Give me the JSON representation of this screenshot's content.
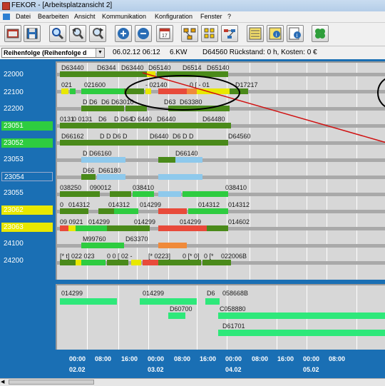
{
  "window": {
    "title": "FEKOR - [Arbeitsplatzansicht 2]"
  },
  "menu": [
    "Datei",
    "Bearbeiten",
    "Ansicht",
    "Kommunikation",
    "Konfiguration",
    "Fenster",
    "?"
  ],
  "toolbar": {
    "buttons": [
      "new-window-icon",
      "save-icon",
      "zoom-icon",
      "zoom-back-icon",
      "zoom-forward-icon",
      "zoom-in-icon",
      "zoom-out-icon",
      "calendar-icon",
      "structure-icon",
      "grid-icon",
      "network-icon",
      "list-icon",
      "info-icon",
      "info-doc-icon",
      "clover-icon"
    ]
  },
  "status": {
    "combo_value": "Reihenfolge (Reihenfolge d",
    "date": "06.02.12 06:12",
    "week": "6.KW",
    "summary": "D64560 Rückstand: 0 h, Kosten: 0 €"
  },
  "resources": [
    {
      "id": "22000",
      "style": "plain"
    },
    {
      "id": "22100",
      "style": "plain"
    },
    {
      "id": "22200",
      "style": "plain"
    },
    {
      "id": "23051",
      "style": "green"
    },
    {
      "id": "23052",
      "style": "green"
    },
    {
      "id": "23053",
      "style": "plain"
    },
    {
      "id": "23054",
      "style": "plain"
    },
    {
      "id": "23055",
      "style": "plain"
    },
    {
      "id": "23062",
      "style": "yellow"
    },
    {
      "id": "23063",
      "style": "yellow"
    },
    {
      "id": "24100",
      "style": "plain"
    },
    {
      "id": "24200",
      "style": "plain"
    }
  ],
  "gantt_labels": [
    "D63440",
    "D6344",
    "D63440",
    "D65140",
    "D6514",
    "D65140",
    "021",
    "021600",
    "- 02140",
    "0 [ - 01",
    "D17217",
    "D D6",
    "D6 D63010",
    "D63",
    "D63380",
    "0131",
    "0 0131",
    "D6",
    "D D64",
    "D 6440",
    "D6440",
    "D64480",
    "D66162",
    "D D D6 D",
    "D6440",
    "D6 D D",
    "D64560",
    "D D66160",
    "D66140",
    "D66",
    "D66180",
    "038250",
    "090012",
    "038410",
    "038410",
    "0",
    "014312",
    "014312",
    "014299",
    "014312",
    "014312",
    "09 0921",
    "014299",
    "014299",
    "014299",
    "014602",
    "M99760",
    "D63370",
    "[* t] 022 023",
    "0 0 [ 02 -",
    "[* 0223]",
    "0 [* 0]",
    "0 [*",
    "022006B"
  ],
  "lower_labels": [
    "014299",
    "014299",
    "D6",
    "058668B",
    "D60700",
    "C058880",
    "D61701"
  ],
  "axis": {
    "ticks": [
      "00:00",
      "08:00",
      "16:00",
      "00:00",
      "08:00",
      "16:00",
      "00:00",
      "08:00",
      "16:00",
      "00:00",
      "08:00"
    ],
    "dates": [
      "02.02",
      "03.02",
      "04.02",
      "05.02"
    ]
  },
  "colors": {
    "accent": "#1a6fb4",
    "bar_green": "#2ecc40",
    "bar_darkgreen": "#4a8a1a",
    "bar_red": "#e84a3a",
    "bar_yellow": "#e8e800",
    "bar_blue": "#8ec9ec",
    "bar_orange": "#f08a3a",
    "highlight_stroke": "#000000",
    "trend_line": "#d01010"
  }
}
